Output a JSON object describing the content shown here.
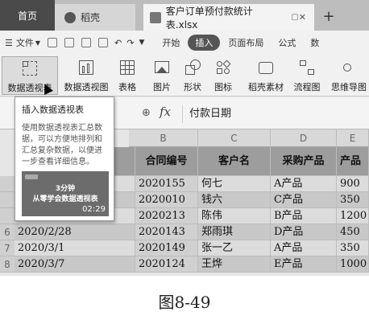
{
  "tabs": {
    "home": "首页",
    "wps": "稻壳",
    "file": "客户订单预付款统计表.xlsx"
  },
  "menu": {
    "file": "文件",
    "items": [
      "开始",
      "插入",
      "页面布局",
      "公式",
      "数"
    ],
    "active_item": "插入"
  },
  "toolbar": {
    "pivot_table": "数据透视表",
    "pivot_chart": "数据透视图",
    "table": "表格",
    "picture": "图片",
    "shape": "形状",
    "icon": "图标",
    "premium": "稻壳素材",
    "flowchart": "流程图",
    "mindmap": "思维导图"
  },
  "formula_bar": {
    "fx": "fx",
    "value": "付款日期"
  },
  "grid": {
    "columns": [
      "B",
      "C",
      "D",
      "E"
    ],
    "headers": [
      "合同编号",
      "客户名",
      "采购产品",
      "产品"
    ],
    "rows": [
      {
        "num": "",
        "date": "",
        "id": "2020155",
        "name": "何七",
        "product": "A产品",
        "qty": "900"
      },
      {
        "num": "",
        "date": "",
        "id": "2020010",
        "name": "钱六",
        "product": "C产品",
        "qty": "350"
      },
      {
        "num": "",
        "date": "",
        "id": "2020213",
        "name": "陈伟",
        "product": "B产品",
        "qty": "1200"
      },
      {
        "num": "6",
        "date": "2020/2/28",
        "id": "2020143",
        "name": "郑雨琪",
        "product": "D产品",
        "qty": "450"
      },
      {
        "num": "7",
        "date": "2020/3/1",
        "id": "2020149",
        "name": "张一乙",
        "product": "A产品",
        "qty": "350"
      },
      {
        "num": "8",
        "date": "2020/3/7",
        "id": "2020124",
        "name": "王烨",
        "product": "E产品",
        "qty": "1000"
      }
    ]
  },
  "tooltip": {
    "title": "插入数据透视表",
    "body": "使用数据透视表汇总数据，可以方便地排列和汇总复杂数据，以便进一步查看详细信息。",
    "video_line1": "3分钟",
    "video_line2": "从零学会数据透视表",
    "video_duration": "02:29"
  },
  "caption": "图8-49"
}
